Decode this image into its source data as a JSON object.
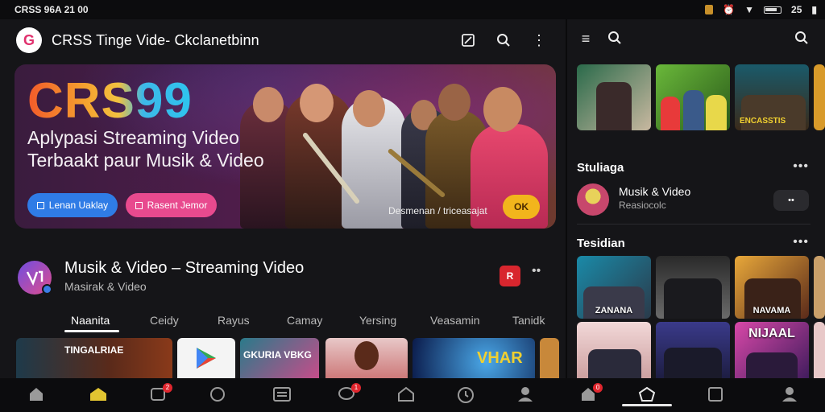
{
  "status": {
    "time": "CRSS 96A 21 00",
    "battery": "25"
  },
  "left": {
    "app_title": "CRSS Tinge Vide- Ckclanetbinn",
    "logo_letter": "G",
    "banner": {
      "brand": "CRS99",
      "tagline1": "Aplypasi Streaming Video",
      "tagline2": "Terbaakt paur Musik & Video",
      "btn1": "Lenan Uaklay",
      "btn2": "Rasent Jemor",
      "caption": "Desmenan / triceasajat",
      "pill": "OK"
    },
    "channel": {
      "title": "Musik & Video – Streaming Video",
      "subtitle": "Masirak & Video",
      "badge": "R"
    },
    "tabs": [
      "Naanita",
      "Ceidy",
      "Rayus",
      "Camay",
      "Yersing",
      "Veasamin",
      "Tanidk"
    ],
    "thumbs": [
      "TINGALRIAE",
      "GKURIA VBKG",
      "VHAR"
    ]
  },
  "right": {
    "section1": "Stuliaga",
    "item": {
      "title": "Musik & Video",
      "subtitle": "Reasiocolc",
      "btn": "••"
    },
    "section2": "Tesidian",
    "top_labels": [
      "",
      "",
      "ENCASSTIS"
    ],
    "grid_labels": [
      "ZANANA",
      "",
      "NAVAMA",
      "",
      "",
      "NIJAAL"
    ]
  },
  "nav_badges": {
    "b1": "2",
    "b2": "1",
    "b3": "0"
  },
  "colors": {
    "accent_yellow": "#e2c531",
    "badge_red": "#e0262e",
    "blue": "#2f7ce6",
    "pink": "#e84a8e"
  }
}
